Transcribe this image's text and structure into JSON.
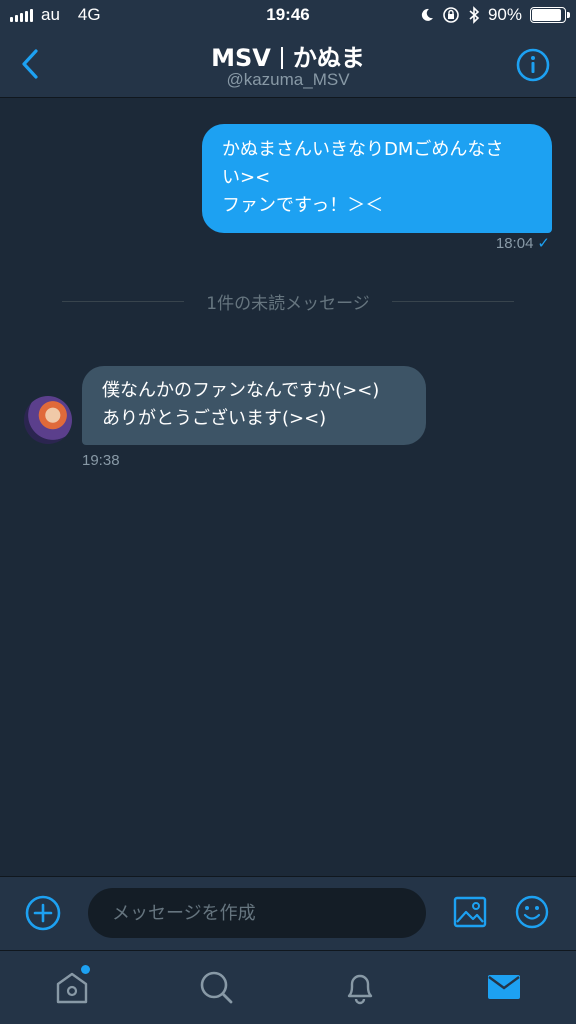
{
  "status_bar": {
    "carrier": "au",
    "network": "4G",
    "time": "19:46",
    "battery": "90%",
    "battery_level": 0.9
  },
  "header": {
    "name_left": "MSV",
    "name_right": "かぬま",
    "handle": "@kazuma_MSV",
    "back_icon": "chevron-left-icon",
    "info_icon": "info-icon"
  },
  "messages": {
    "outgoing": {
      "line1": "かぬまさんいきなりDMごめんなさ",
      "line2": "い><",
      "line3": "ファンですっ！＞＜",
      "time": "18:04",
      "check": "✓"
    },
    "unread_divider": "1件の未読メッセージ",
    "incoming": {
      "line1": "僕なんかのファンなんですか(><)",
      "line2": "ありがとうございます(><)",
      "time": "19:38"
    }
  },
  "composer": {
    "placeholder": "メッセージを作成"
  },
  "tabs": [
    "home-icon",
    "search-icon",
    "bell-icon",
    "mail-icon"
  ],
  "colors": {
    "accent": "#1da1f2",
    "background": "#1c2938",
    "bar": "#243447",
    "incoming_bubble": "#3d5466"
  }
}
